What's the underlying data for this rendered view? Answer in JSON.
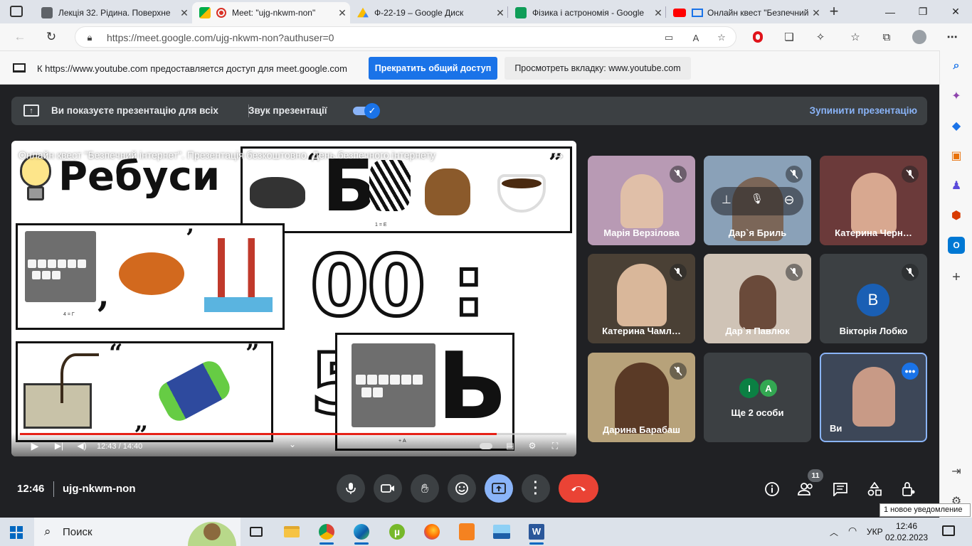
{
  "browser": {
    "tabs": [
      {
        "title": "Лекція 32. Рідина. Поверхне",
        "icon": "document-icon",
        "color": "#5f6368"
      },
      {
        "title": "Meet: \"ujg-nkwm-non\"",
        "icon": "meet-icon",
        "color": "#00ac47",
        "active": true,
        "recording": true
      },
      {
        "title": "Ф-22-19 – Google Диск",
        "icon": "drive-icon",
        "color": "#fbbc04"
      },
      {
        "title": "Фізика і астрономія - Google",
        "icon": "sheets-icon",
        "color": "#0f9d58"
      },
      {
        "title": "Онлайн квест \"Безпечний",
        "icon": "youtube-icon",
        "color": "#ff0000"
      }
    ],
    "url": "https://meet.google.com/ujg-nkwm-non?authuser=0"
  },
  "share_bar": {
    "text": "К https://www.youtube.com предоставляется доступ для meet.google.com",
    "stop_button": "Прекратить общий доступ",
    "view_tab_button": "Просмотреть вкладку: www.youtube.com"
  },
  "meet": {
    "present_bar": {
      "presenting_text": "Ви показуєте презентацію для всіх",
      "sound_label": "Звук презентації",
      "sound_enabled": true,
      "stop_label": "Зупинити презентацію"
    },
    "video": {
      "title": "Онлайн квест \"Безпечний інтернет\". Презентація безкоштовно. День безпечного інтернету",
      "slide_heading": "Ребуси",
      "timer": "00 : 53",
      "letter_b": "Б",
      "letter_soft": "Ь",
      "hint_1": "1 = Е",
      "hint_2": "4 = Г",
      "hint_3": "+ А",
      "time_display": "12:43 / 14:40",
      "progress": 0.873
    },
    "participants": [
      {
        "name": "Марія Верзілова",
        "muted": true,
        "kind": "video"
      },
      {
        "name": "Дар`я Бриль",
        "muted": true,
        "kind": "video",
        "hovered": true
      },
      {
        "name": "Катерина Черн…",
        "muted": true,
        "kind": "video"
      },
      {
        "name": "Катерина Чамл…",
        "muted": true,
        "kind": "video"
      },
      {
        "name": "Дар`я Павлюк",
        "muted": true,
        "kind": "video"
      },
      {
        "name": "Вікторія Лобко",
        "muted": true,
        "kind": "avatar",
        "initial": "В"
      },
      {
        "name": "Дарина Барабаш",
        "muted": true,
        "kind": "video"
      },
      {
        "name": "Ще 2 особи",
        "kind": "group",
        "initials": [
          "І",
          "А"
        ]
      },
      {
        "name": "Ви",
        "kind": "self"
      }
    ],
    "time": "12:46",
    "meeting_code": "ujg-nkwm-non",
    "people_count": "11"
  },
  "notification": "1 новое уведомление",
  "taskbar": {
    "search_label": "Поиск",
    "language": "УКР",
    "time": "12:46",
    "date": "02.02.2023"
  },
  "colors": {
    "meet_bg": "#202124",
    "accent_blue": "#1a73e8",
    "hangup_red": "#ea4335",
    "link_blue": "#8ab4f8"
  }
}
